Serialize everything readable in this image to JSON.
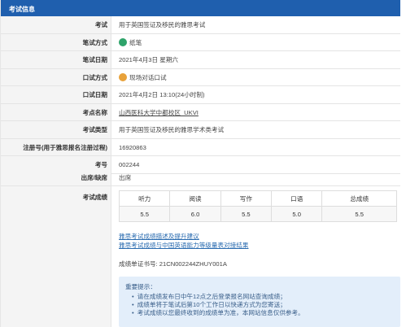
{
  "header": {
    "title": "考试信息"
  },
  "rows": [
    {
      "label": "考试",
      "value": "用于英国签证及移民的雅思考试"
    },
    {
      "label": "笔试方式",
      "value": "纸笔",
      "icon": "pen-icon",
      "icon_color": "#2ea36a"
    },
    {
      "label": "笔试日期",
      "value": "2021年4月3日 星期六"
    },
    {
      "label": "口试方式",
      "value": "现场对话口试",
      "icon": "speech-icon",
      "icon_color": "#e8a23a"
    },
    {
      "label": "口试日期",
      "value": "2021年4月2日 13:10(24小时制)"
    },
    {
      "label": "考点名称",
      "value": "山西医科大学中都校区_UKVI"
    },
    {
      "label": "考试类型",
      "value": "用于英国签证及移民的雅思学术类考试"
    },
    {
      "label": "注册号(用于雅思报名注册过程)",
      "value": "16920863"
    },
    {
      "label": "考号",
      "value": "002244"
    },
    {
      "label": "出席/缺席",
      "value": "出席"
    }
  ],
  "scores": {
    "label": "考试成绩",
    "headers": [
      "听力",
      "阅读",
      "写作",
      "口语",
      "总成绩"
    ],
    "values": [
      "5.5",
      "6.0",
      "5.5",
      "5.0",
      "5.5"
    ]
  },
  "links": [
    "雅思考试成绩描述及提升建议",
    "雅思考试成绩与中国英语能力等级量表对接结果"
  ],
  "cert": "成绩单证书号: 21CN002244ZHUY001A",
  "notice": {
    "title": "重要提示：",
    "items": [
      "请在成绩发布日中午12点之后登录报名网站查询成绩；",
      "成绩单将于笔试后第10个工作日以快递方式为您寄送；",
      "考试成绩以您最终收到的成绩单为准，本网站信息仅供参考。"
    ]
  },
  "colors": {
    "header_bg": "#1f5fae",
    "link": "#2b6cb0",
    "notice_bg": "#e3eefa"
  }
}
